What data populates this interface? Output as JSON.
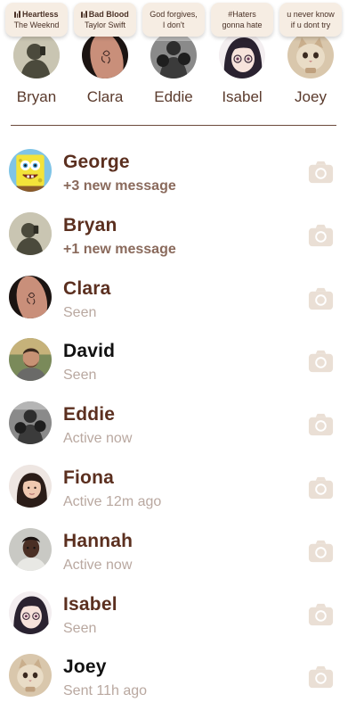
{
  "stories": [
    {
      "name": "Bryan",
      "note": {
        "music": true,
        "line1": "Heartless",
        "line2": "The Weeknd"
      },
      "avatar": "silhouette-avatar"
    },
    {
      "name": "Clara",
      "note": {
        "music": true,
        "line1": "Bad Blood",
        "line2": "Taylor Swift"
      },
      "avatar": "tattoo-avatar"
    },
    {
      "name": "Eddie",
      "note": {
        "music": false,
        "line1": "God forgives,",
        "line2": "I don't"
      },
      "avatar": "boxer-avatar"
    },
    {
      "name": "Isabel",
      "note": {
        "music": false,
        "line1": "#Haters",
        "line2": "gonna hate"
      },
      "avatar": "anime-girl-avatar"
    },
    {
      "name": "Joey",
      "note": {
        "music": false,
        "line1": "u never know",
        "line2": "if u dont try"
      },
      "avatar": "cat-avatar"
    }
  ],
  "conversations": [
    {
      "name": "George",
      "status": "+3 new message",
      "unread": true,
      "avatar": "sponge-avatar"
    },
    {
      "name": "Bryan",
      "status": "+1 new message",
      "unread": true,
      "avatar": "silhouette-avatar"
    },
    {
      "name": "Clara",
      "status": "Seen",
      "unread": false,
      "avatar": "tattoo-avatar"
    },
    {
      "name": "David",
      "status": "Seen",
      "unread": false,
      "avatar": "man-photo-avatar"
    },
    {
      "name": "Eddie",
      "status": "Active now",
      "unread": false,
      "avatar": "boxer-avatar"
    },
    {
      "name": "Fiona",
      "status": "Active 12m ago",
      "unread": false,
      "avatar": "woman-photo-avatar"
    },
    {
      "name": "Hannah",
      "status": "Active now",
      "unread": false,
      "avatar": "woman-photo-avatar-2"
    },
    {
      "name": "Isabel",
      "status": "Seen",
      "unread": false,
      "avatar": "anime-girl-avatar"
    },
    {
      "name": "Joey",
      "status": "Sent 11h ago",
      "unread": false,
      "avatar": "cat-avatar"
    }
  ],
  "colors": {
    "name_brown": "#5b2f1f",
    "name_dark": "#111111",
    "status_unread": "#8a6a5c",
    "status_read": "#b9a8a0",
    "camera_icon": "#eadfd5",
    "note_bg": "#f6ede3",
    "divider": "#6b4a3b"
  },
  "icons": {
    "camera": "camera-icon",
    "music": "music-bars-icon"
  }
}
